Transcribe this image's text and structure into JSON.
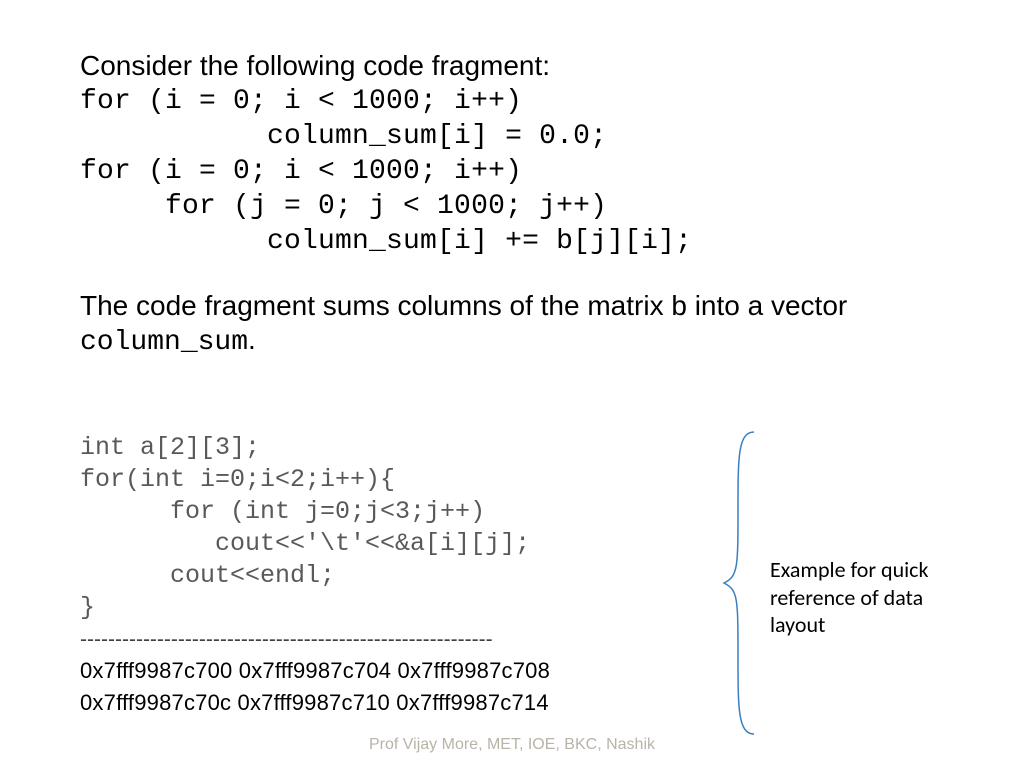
{
  "intro": "Consider the following code fragment:",
  "code1": "for (i = 0; i < 1000; i++)\n           column_sum[i] = 0.0;\nfor (i = 0; i < 1000; i++)\n     for (j = 0; j < 1000; j++)\n           column_sum[i] += b[j][i];",
  "desc_pre": "The code fragment sums columns of the matrix b into a vector ",
  "desc_mono": "column_sum",
  "desc_post": ".",
  "code2": "int a[2][3];\nfor(int i=0;i<2;i++){\n      for (int j=0;j<3;j++)\n         cout<<'\\t'<<&a[i][j];\n      cout<<endl;\n}",
  "dashline": "-----------------------------------------------------------",
  "addr_rows": [
    "0x7fff9987c700   0x7fff9987c704   0x7fff9987c708",
    "0x7fff9987c70c   0x7fff9987c710   0x7fff9987c714"
  ],
  "brace_label": "Example for quick reference of data layout",
  "footer": "Prof Vijay More, MET, IOE, BKC, Nashik"
}
